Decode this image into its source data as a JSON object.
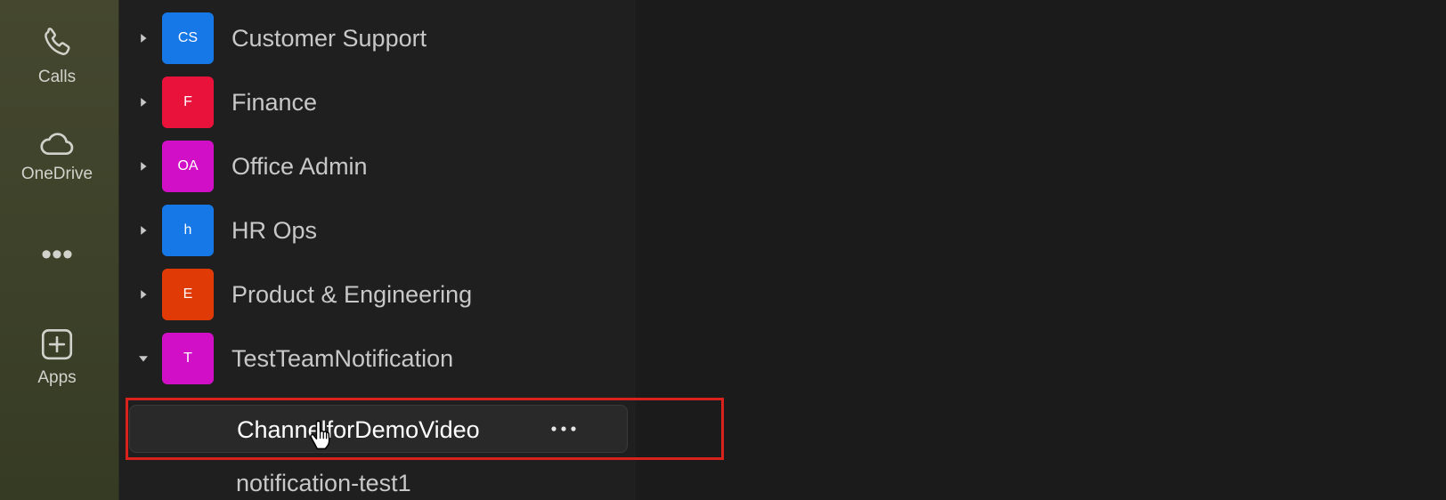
{
  "rail": {
    "items": [
      {
        "label": "Calls",
        "icon": "phone-icon"
      },
      {
        "label": "OneDrive",
        "icon": "cloud-icon"
      },
      {
        "label": "Apps",
        "icon": "add-square-icon"
      }
    ],
    "more_label": "•••"
  },
  "teams": [
    {
      "initials": "CS",
      "name": "Customer Support",
      "color": "#1677e6",
      "expanded": false
    },
    {
      "initials": "F",
      "name": "Finance",
      "color": "#e8123a",
      "expanded": false
    },
    {
      "initials": "OA",
      "name": "Office Admin",
      "color": "#d10fc6",
      "expanded": false
    },
    {
      "initials": "h",
      "name": "HR Ops",
      "color": "#1677e6",
      "expanded": false
    },
    {
      "initials": "E",
      "name": "Product & Engineering",
      "color": "#e03a06",
      "expanded": false
    },
    {
      "initials": "T",
      "name": "TestTeamNotification",
      "color": "#d10fc6",
      "expanded": true
    }
  ],
  "channels": [
    {
      "name": "ChannelforDemoVideo",
      "more_label": "•••",
      "hovered": true
    },
    {
      "name": "notification-test1",
      "hovered": false
    }
  ],
  "colors": {
    "highlight": "#d9221b",
    "list_background": "#1f1f1f",
    "rail_background": "#45482f"
  }
}
